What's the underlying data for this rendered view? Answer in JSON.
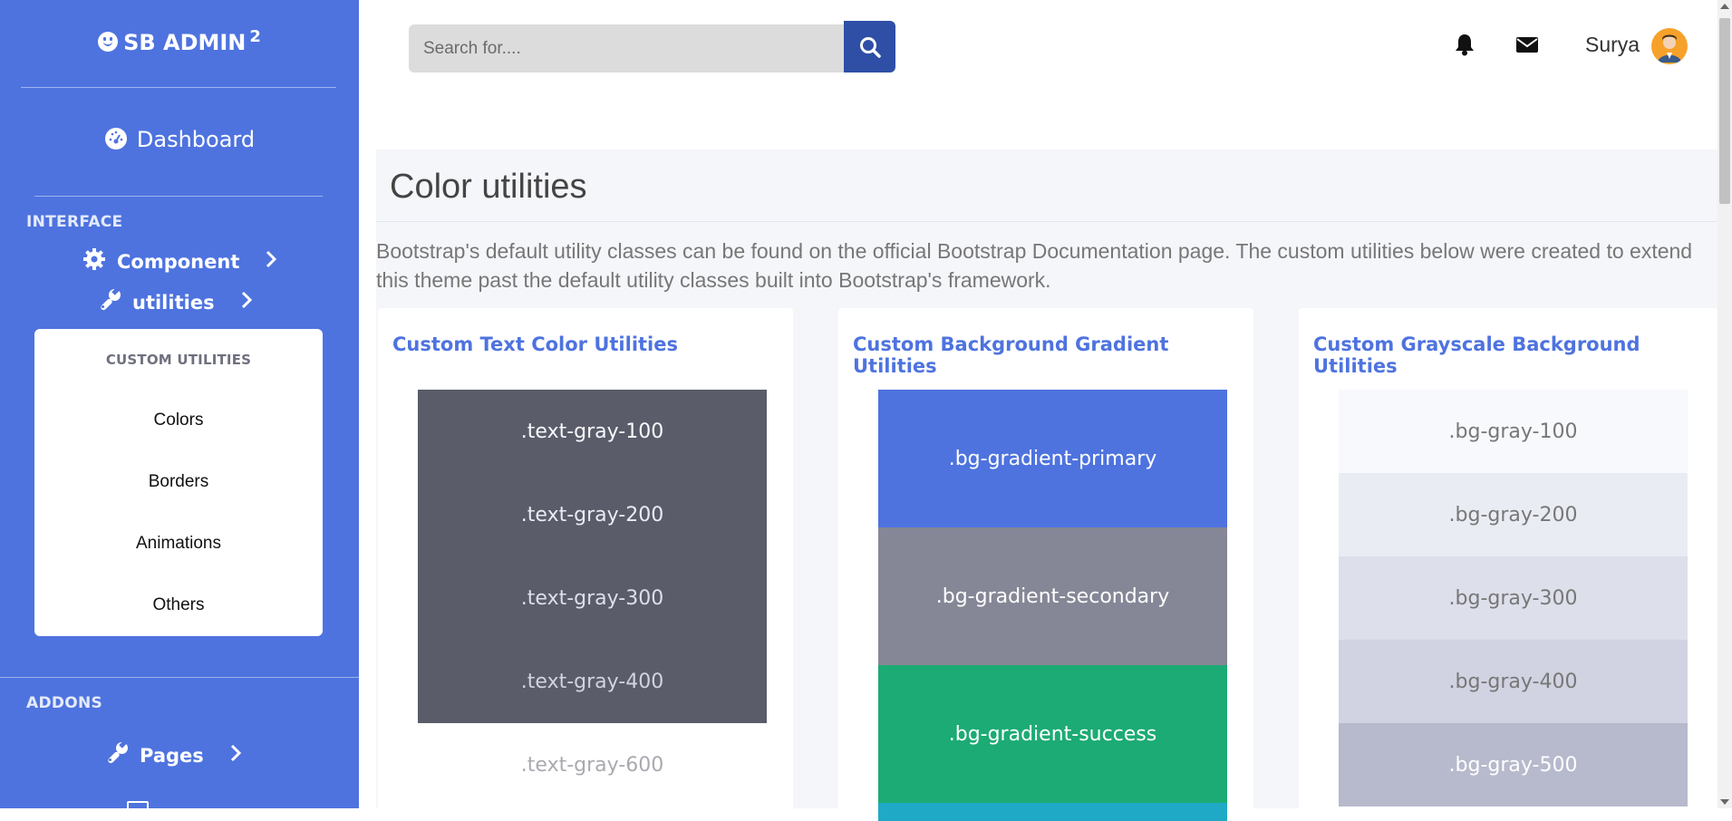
{
  "brand": {
    "name": "SB ADMIN",
    "sup": "2"
  },
  "sidebar": {
    "dashboard": "Dashboard",
    "heading_interface": "INTERFACE",
    "component": "Component",
    "utilities": "utilities",
    "collapse_header": "CUSTOM UTILITIES",
    "collapse_items": [
      "Colors",
      "Borders",
      "Animations",
      "Others"
    ],
    "heading_addons": "ADDONS",
    "pages": "Pages"
  },
  "topbar": {
    "search_placeholder": "Search for....",
    "user_name": "Surya"
  },
  "page": {
    "title": "Color utilities",
    "description": "Bootstrap's default utility classes can be found on the official Bootstrap Documentation page. The custom utilities below were created to extend this theme past the default utility classes built into Bootstrap's framework."
  },
  "cards": {
    "text_color": {
      "title": "Custom Text Color Utilities",
      "items": [
        ".text-gray-100",
        ".text-gray-200",
        ".text-gray-300",
        ".text-gray-400",
        ".text-gray-600"
      ]
    },
    "gradient": {
      "title": "Custom Background Gradient Utilities",
      "items": [
        ".bg-gradient-primary",
        ".bg-gradient-secondary",
        ".bg-gradient-success"
      ]
    },
    "grayscale": {
      "title": "Custom Grayscale Background Utilities",
      "items": [
        ".bg-gray-100",
        ".bg-gray-200",
        ".bg-gray-300",
        ".bg-gray-400",
        ".bg-gray-500"
      ]
    }
  },
  "colors": {
    "sidebar": "#4e73df",
    "primary_gradient": "#4e73df",
    "secondary_gradient": "#858796",
    "success_gradient": "#1cab74",
    "text_swatch_bg": "#5a5c69",
    "gray_100": "#f8f9fc",
    "gray_200": "#eaecf4",
    "gray_300": "#dddfeb",
    "gray_400": "#d1d3e2",
    "gray_500": "#b7b9cc"
  }
}
